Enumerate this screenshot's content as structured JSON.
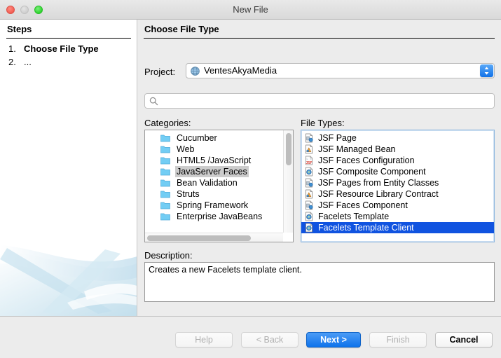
{
  "window": {
    "title": "New File",
    "traffic_lights": [
      "close-button",
      "minimize-button",
      "maximize-button"
    ]
  },
  "steps": {
    "heading": "Steps",
    "items": [
      {
        "number": "1.",
        "label": "Choose File Type",
        "active": true
      },
      {
        "number": "2.",
        "label": "...",
        "active": false
      }
    ]
  },
  "panel": {
    "title": "Choose File Type"
  },
  "project": {
    "label": "Project:",
    "icon": "globe-icon",
    "value": "VentesAkyaMedia"
  },
  "search": {
    "icon": "search-icon",
    "value": "",
    "placeholder": ""
  },
  "categories": {
    "label": "Categories:",
    "items": [
      {
        "label": "Cucumber",
        "icon": "folder-icon",
        "selected": false
      },
      {
        "label": "Web",
        "icon": "folder-icon",
        "selected": false
      },
      {
        "label": "HTML5 /JavaScript",
        "icon": "folder-icon",
        "selected": false
      },
      {
        "label": "JavaServer Faces",
        "icon": "folder-icon",
        "selected": true
      },
      {
        "label": "Bean Validation",
        "icon": "folder-icon",
        "selected": false
      },
      {
        "label": "Struts",
        "icon": "folder-icon",
        "selected": false
      },
      {
        "label": "Spring Framework",
        "icon": "folder-icon",
        "selected": false
      },
      {
        "label": "Enterprise JavaBeans",
        "icon": "folder-icon",
        "selected": false
      }
    ]
  },
  "file_types": {
    "label": "File Types:",
    "items": [
      {
        "label": "JSF Page",
        "icon": "jsf-page-file-icon",
        "selected": false
      },
      {
        "label": "JSF Managed Bean",
        "icon": "jsf-bean-file-icon",
        "selected": false
      },
      {
        "label": "JSF Faces Configuration",
        "icon": "jsf-config-file-icon",
        "selected": false
      },
      {
        "label": "JSF Composite Component",
        "icon": "jsf-composite-file-icon",
        "selected": false
      },
      {
        "label": "JSF Pages from Entity Classes",
        "icon": "jsf-page-file-icon",
        "selected": false
      },
      {
        "label": "JSF Resource Library Contract",
        "icon": "jsf-bean-file-icon",
        "selected": false
      },
      {
        "label": "JSF Faces Component",
        "icon": "jsf-page-file-icon",
        "selected": false
      },
      {
        "label": "Facelets Template",
        "icon": "jsf-composite-file-icon",
        "selected": false
      },
      {
        "label": "Facelets Template Client",
        "icon": "jsf-composite-file-icon",
        "selected": true
      }
    ]
  },
  "description": {
    "label": "Description:",
    "text": "Creates a new Facelets template client."
  },
  "footer": {
    "help": "Help",
    "back": "< Back",
    "next": "Next >",
    "finish": "Finish",
    "cancel": "Cancel"
  },
  "colors": {
    "selection_blue": "#1053e0",
    "primary_button_blue": "#0e73eb",
    "inactive_selection_gray": "#cccccc",
    "window_background": "#ececec",
    "list_background": "#ffffff"
  }
}
